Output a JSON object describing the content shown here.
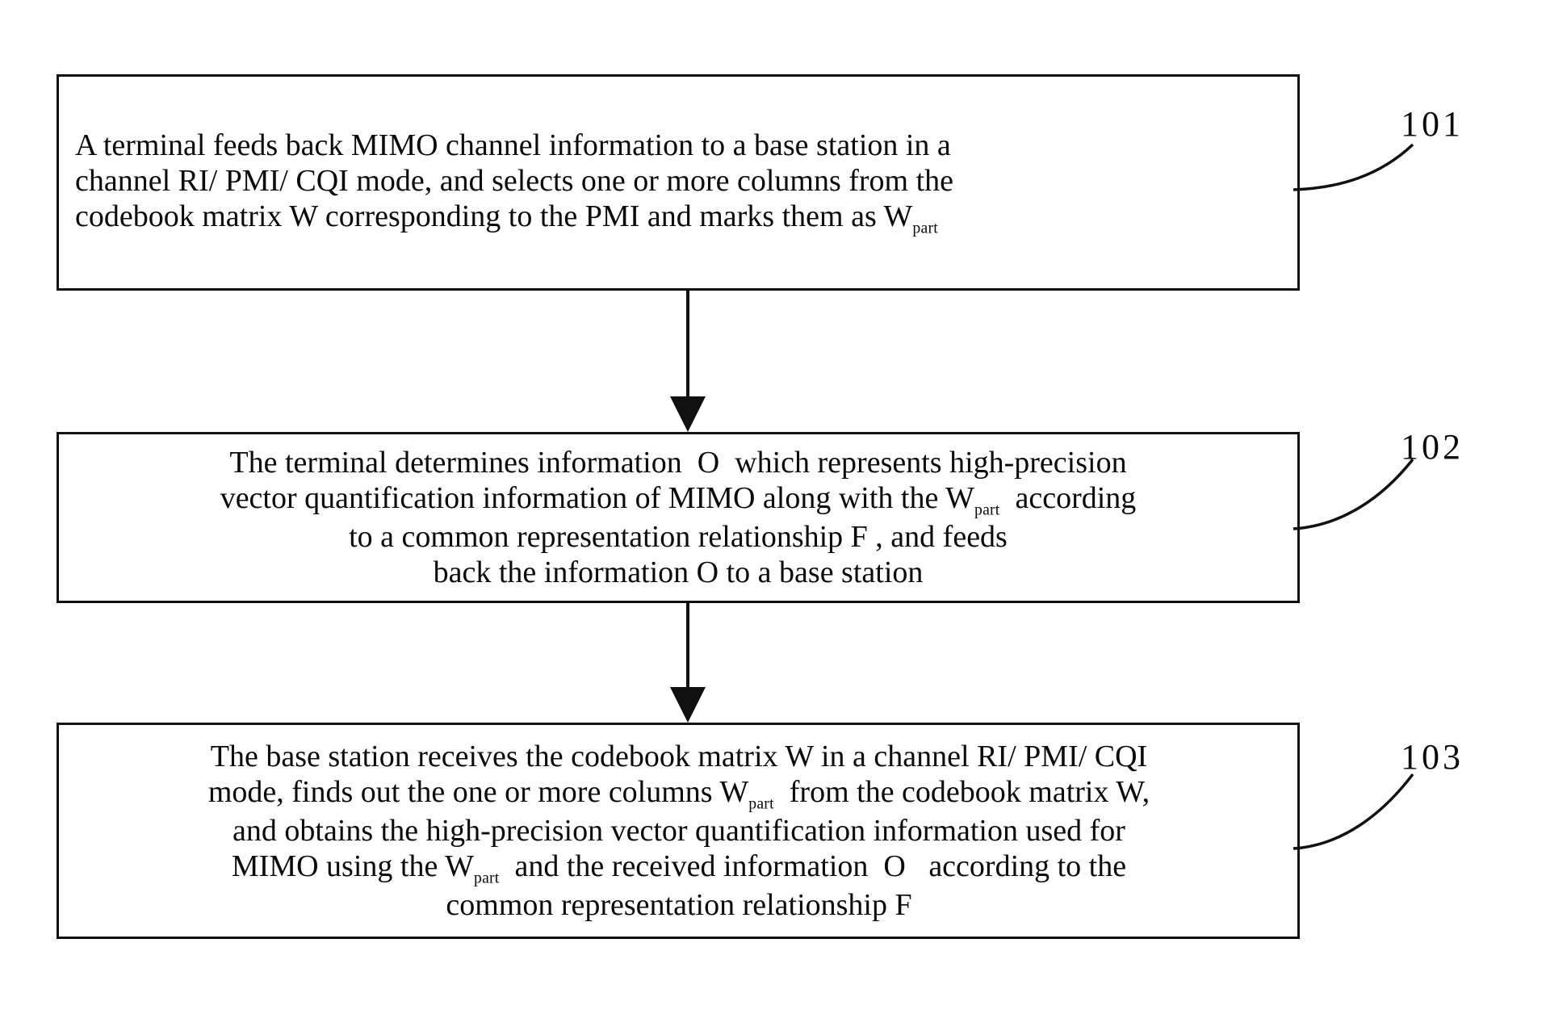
{
  "diagram": {
    "type": "flowchart",
    "title": "MIMO channel information feedback method flowchart",
    "background_color": "#ffffff",
    "line_color": "#111111",
    "text_color": "#0b0b0b",
    "steps": [
      {
        "ref": "101",
        "align": "left",
        "text_plain": "A terminal feeds back MIMO channel information to a base station in a channel RI/ PMI/ CQI mode, and selects one or more columns from the codebook matrix W corresponding to the PMI and marks them as Wpart",
        "text_html": "A terminal feeds back MIMO channel information to a base station in a\nchannel RI/ PMI/ CQI mode, and selects one or more columns from the\ncodebook matrix W corresponding to the PMI and marks them as W<span class=\"sub\">part</span>"
      },
      {
        "ref": "102",
        "align": "center",
        "text_plain": "The terminal determines information O which represents high-precision vector quantification information of MIMO along with the Wpart according to a common representation relationship F , and feeds back the information O to a base station",
        "text_html": "The terminal determines information  O  which represents high-precision\nvector quantification information of MIMO along with the W<span class=\"sub\">part</span>  according\nto a common representation relationship F , and feeds\nback the information O to a base station"
      },
      {
        "ref": "103",
        "align": "center",
        "text_plain": "The base station receives the codebook matrix W in a channel RI/ PMI/ CQI mode, finds out the one or more columns Wpart from the codebook matrix W, and obtains the high-precision vector quantification information used for MIMO using the Wpart and the received information O according to the common representation relationship F",
        "text_html": "The base station receives the codebook matrix W in a channel RI/ PMI/ CQI\nmode, finds out the one or more columns W<span class=\"sub\">part</span>  from the codebook matrix W,\nand obtains the high-precision vector quantification information used for\nMIMO using the W<span class=\"sub\">part</span>  and the received information  O   according to the\ncommon representation relationship F"
      }
    ],
    "connectors": [
      {
        "from": "101",
        "to": "102",
        "style": "solid-line-with-filled-arrowhead",
        "direction": "down"
      },
      {
        "from": "102",
        "to": "103",
        "style": "solid-line-with-filled-arrowhead",
        "direction": "down"
      }
    ]
  }
}
